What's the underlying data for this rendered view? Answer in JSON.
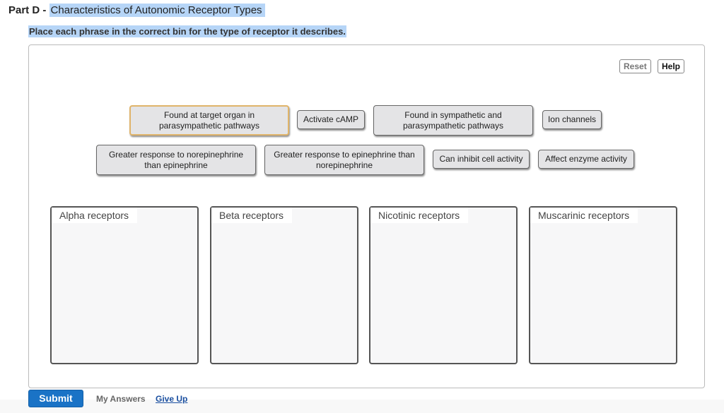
{
  "header": {
    "part_label": "Part D -",
    "title": "Characteristics of Autonomic Receptor Types",
    "instruction": "Place each phrase in the correct bin for the type of receptor it describes."
  },
  "toolbar": {
    "reset_label": "Reset",
    "help_label": "Help"
  },
  "phrases": [
    {
      "text": "Found at target organ in parasympathetic pathways",
      "selected": true
    },
    {
      "text": "Activate cAMP",
      "selected": false
    },
    {
      "text": "Found in sympathetic and parasympathetic pathways",
      "selected": false
    },
    {
      "text": "Ion channels",
      "selected": false
    },
    {
      "text": "Greater response to norepinephrine than epinephrine",
      "selected": false
    },
    {
      "text": "Greater response to epinephrine than norepinephrine",
      "selected": false
    },
    {
      "text": "Can inhibit cell activity",
      "selected": false
    },
    {
      "text": "Affect enzyme activity",
      "selected": false
    }
  ],
  "bins": [
    {
      "label": "Alpha receptors"
    },
    {
      "label": "Beta receptors"
    },
    {
      "label": "Nicotinic receptors"
    },
    {
      "label": "Muscarinic receptors"
    }
  ],
  "footer": {
    "submit_label": "Submit",
    "my_answers_label": "My Answers",
    "give_up_label": "Give Up"
  },
  "colors": {
    "highlight": "#b6d5f7",
    "submit": "#1a73c6",
    "selected_border": "#e0b46a"
  }
}
